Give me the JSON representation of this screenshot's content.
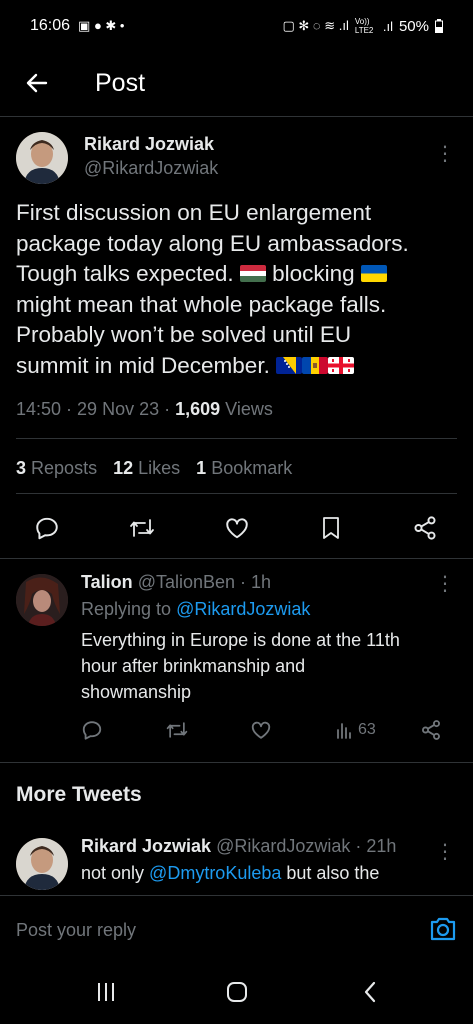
{
  "status_bar": {
    "time": "16:06",
    "battery": "50%",
    "network": "Vo)) LTE2"
  },
  "header": {
    "title": "Post"
  },
  "main_tweet": {
    "author_name": "Rikard Jozwiak",
    "author_handle": "@RikardJozwiak",
    "text_line1": "First discussion on EU enlargement",
    "text_line2": "package today along EU ambassadors.",
    "text_line3a": "Tough talks expected. ",
    "text_line3b": " blocking ",
    "text_line4": "might mean that whole package falls.",
    "text_line5": "Probably won’t be solved until EU",
    "text_line6": "summit in mid December. ",
    "time": "14:50",
    "date": "29 Nov 23",
    "views_count": "1,609",
    "views_label": "Views",
    "reposts_count": "3",
    "reposts_label": "Reposts",
    "likes_count": "12",
    "likes_label": "Likes",
    "bookmarks_count": "1",
    "bookmarks_label": "Bookmark"
  },
  "reply": {
    "name": "Talion",
    "handle": "@TalionBen",
    "age": "1h",
    "replying_to_label": "Replying to",
    "replying_to_handle": "@RikardJozwiak",
    "text_line1": "Everything in Europe is done at the 11th",
    "text_line2": "hour after brinkmanship and",
    "text_line3": "showmanship",
    "views": "63"
  },
  "more_tweets": {
    "title": "More Tweets",
    "items": [
      {
        "name": "Rikard Jozwiak",
        "handle": "@RikardJozwiak",
        "age": "21h",
        "text_prefix": "not only ",
        "mention": "@DmytroKuleba",
        "text_suffix": " but also the"
      }
    ]
  },
  "compose": {
    "placeholder": "Post your reply"
  },
  "colors": {
    "background": "#000000",
    "text": "#e7e9ea",
    "muted": "#71767b",
    "link": "#1d9bf0",
    "divider": "#2f3336"
  },
  "icons": [
    "back-arrow-icon",
    "more-vertical-icon",
    "reply-icon",
    "repost-icon",
    "like-icon",
    "bookmark-icon",
    "share-icon",
    "views-icon",
    "camera-icon",
    "recents-icon",
    "home-icon",
    "back-nav-icon"
  ]
}
